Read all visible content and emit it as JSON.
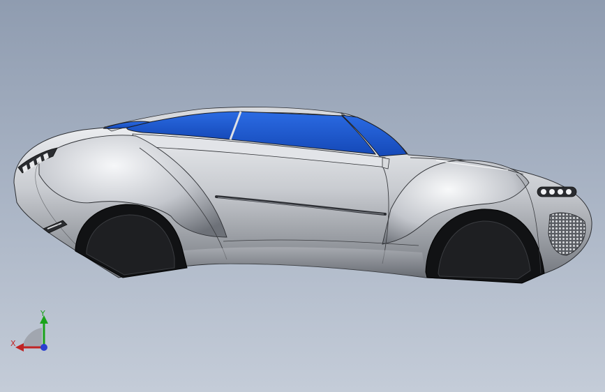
{
  "viewport": {
    "background_top": "#8f9cb0",
    "background_bottom": "#c4ccd8"
  },
  "model": {
    "body_color": "#c9ccd1",
    "glass_color": "#1f5fd6",
    "tire_color": "#1a1a1a"
  },
  "triad": {
    "x_label": "X",
    "y_label": "Y",
    "x_color": "#c02424",
    "y_color": "#1aa31a",
    "z_color": "#2a3fd0"
  }
}
